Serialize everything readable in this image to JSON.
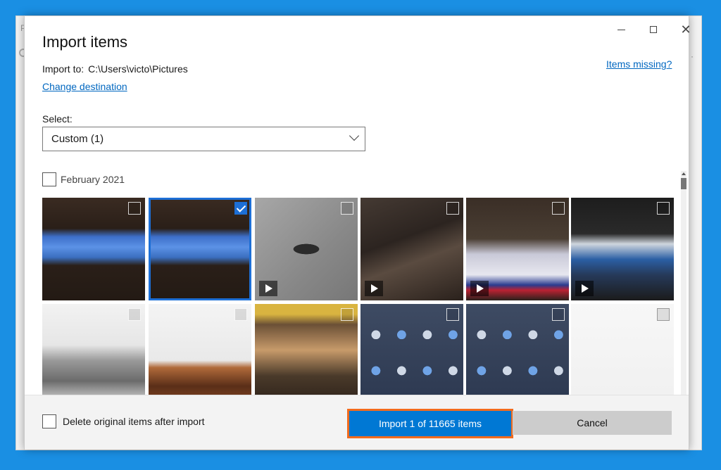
{
  "background_window": {
    "letter": "P",
    "dot": "·"
  },
  "dialog": {
    "title": "Import items",
    "import_to_label": "Import to:",
    "import_to_path": "C:\\Users\\victo\\Pictures",
    "change_destination": "Change destination",
    "items_missing": "Items missing?",
    "select_label": "Select:",
    "select_value": "Custom (1)",
    "group_label": "February 2021",
    "thumbnails": [
      {
        "selected": false,
        "video": false
      },
      {
        "selected": true,
        "video": false
      },
      {
        "selected": false,
        "video": true
      },
      {
        "selected": false,
        "video": true
      },
      {
        "selected": false,
        "video": true
      },
      {
        "selected": false,
        "video": true
      },
      {
        "selected": false,
        "video": false
      },
      {
        "selected": false,
        "video": false
      },
      {
        "selected": false,
        "video": false
      },
      {
        "selected": false,
        "video": false
      },
      {
        "selected": false,
        "video": false
      },
      {
        "selected": false,
        "video": false
      }
    ],
    "delete_original_label": "Delete original items after import",
    "import_button": "Import 1 of 11665 items",
    "cancel_button": "Cancel"
  },
  "colors": {
    "desktop": "#1a8fe3",
    "accent": "#0078d4",
    "highlight": "#f26b1d",
    "link": "#0067c0"
  },
  "icons": {
    "minimize": "minimize-icon",
    "maximize": "maximize-icon",
    "close": "close-icon",
    "dropdown": "chevron-down-icon",
    "play": "play-icon",
    "check": "checkmark-icon"
  }
}
